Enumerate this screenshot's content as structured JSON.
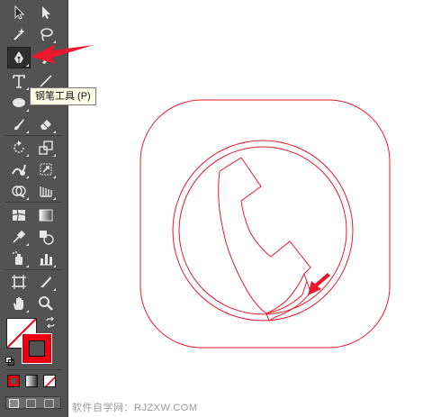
{
  "toolbar": {
    "tools": [
      {
        "name": "selection-tool",
        "icon": "selection-arrow-icon"
      },
      {
        "name": "direct-selection-tool",
        "icon": "direct-selection-arrow-icon"
      },
      {
        "name": "magic-wand-tool",
        "icon": "magic-wand-icon"
      },
      {
        "name": "lasso-tool",
        "icon": "lasso-icon"
      },
      {
        "name": "pen-tool",
        "icon": "pen-icon",
        "active": true
      },
      {
        "name": "curvature-tool",
        "icon": "curvature-pen-icon"
      },
      {
        "name": "type-tool",
        "icon": "type-icon"
      },
      {
        "name": "line-segment-tool",
        "icon": "line-icon"
      },
      {
        "name": "ellipse-tool",
        "icon": "ellipse-icon"
      },
      {
        "name": "paintbrush-tool",
        "icon": "brush-icon"
      },
      {
        "name": "pencil-tool",
        "icon": "pencil-icon"
      },
      {
        "name": "eraser-tool",
        "icon": "eraser-icon"
      },
      {
        "name": "rotate-tool",
        "icon": "rotate-icon"
      },
      {
        "name": "scale-tool",
        "icon": "scale-icon"
      },
      {
        "name": "warp-tool",
        "icon": "warp-icon"
      },
      {
        "name": "free-transform-tool",
        "icon": "free-transform-icon"
      },
      {
        "name": "shape-builder-tool",
        "icon": "shape-builder-icon"
      },
      {
        "name": "perspective-grid-tool",
        "icon": "perspective-grid-icon"
      },
      {
        "name": "mesh-tool",
        "icon": "mesh-icon"
      },
      {
        "name": "gradient-tool",
        "icon": "gradient-icon"
      },
      {
        "name": "eyedropper-tool",
        "icon": "eyedropper-icon"
      },
      {
        "name": "blend-tool",
        "icon": "blend-icon"
      },
      {
        "name": "symbol-sprayer-tool",
        "icon": "symbol-sprayer-icon"
      },
      {
        "name": "column-graph-tool",
        "icon": "column-graph-icon"
      },
      {
        "name": "artboard-tool",
        "icon": "artboard-icon"
      },
      {
        "name": "slice-tool",
        "icon": "slice-icon"
      },
      {
        "name": "hand-tool",
        "icon": "hand-icon"
      },
      {
        "name": "zoom-tool",
        "icon": "zoom-icon"
      }
    ],
    "fill_color": "#ffffff",
    "stroke_color": "#e60012"
  },
  "tooltip": {
    "text": "钢笔工具 (P)"
  },
  "watermark": {
    "text": "软件自学网：RJZXW.COM"
  },
  "colors": {
    "toolbar_bg": "#535353",
    "artwork_stroke": "#e8192c",
    "arrow": "#e8192c"
  }
}
